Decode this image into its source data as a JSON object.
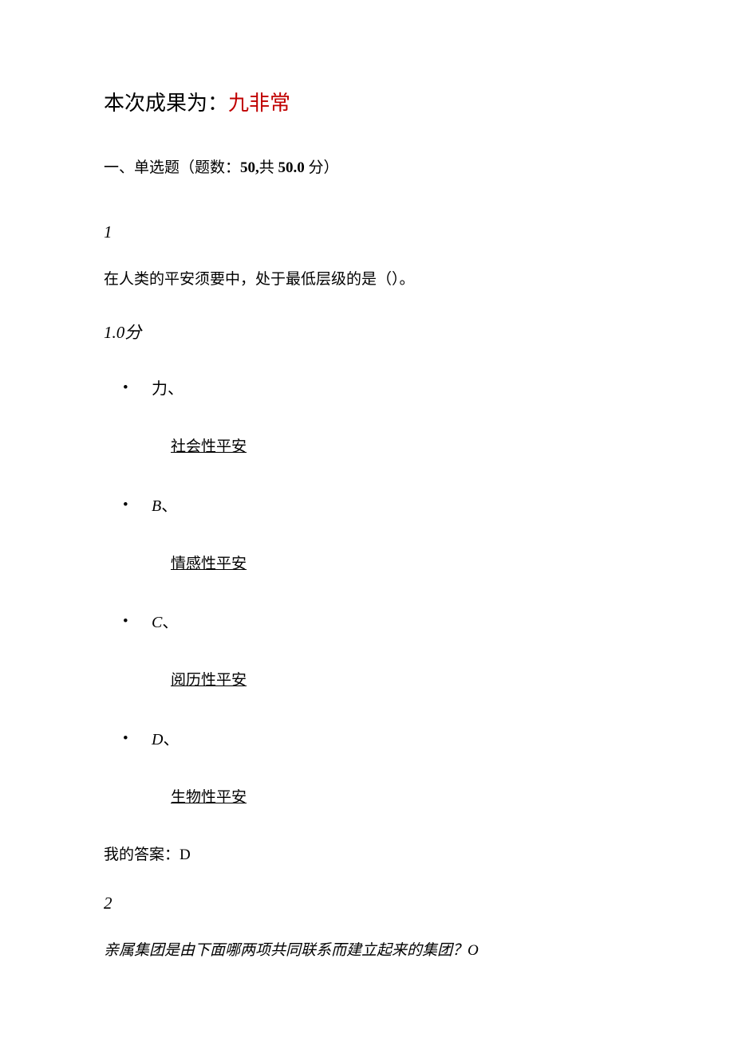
{
  "result": {
    "prefix": "本次成果为：",
    "value": "九非常"
  },
  "section": {
    "prefix": "一、单选题（题数：",
    "count": "50,",
    "mid": "共 ",
    "score": "50.0",
    "suffix": " 分）"
  },
  "question1": {
    "number": "1",
    "text": "在人类的平安须要中，处于最低层级的是（）。",
    "score_num": "1.0",
    "score_unit": "分",
    "options": {
      "a": {
        "label": "力、",
        "text": "社会性平安"
      },
      "b": {
        "label_letter": "B",
        "label_sep": "、",
        "text": "情感性平安"
      },
      "c": {
        "label_letter": "C",
        "label_sep": "、",
        "text": "阅历性平安"
      },
      "d": {
        "label_letter": "D",
        "label_sep": "、",
        "text": "生物性平安"
      }
    },
    "answer": "我的答案：D"
  },
  "question2": {
    "number": "2",
    "text": "亲属集团是由下面哪两项共同联系而建立起来的集团？O"
  }
}
